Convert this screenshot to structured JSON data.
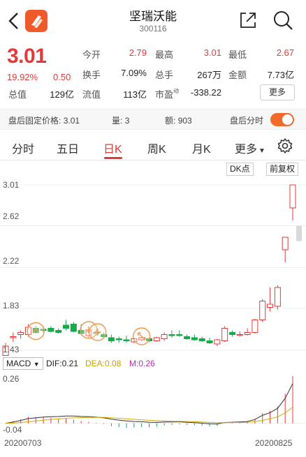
{
  "header": {
    "title": "坚瑞沃能",
    "code": "300116"
  },
  "quote": {
    "price": "3.01",
    "change_pct": "19.92%",
    "change_amt": "0.50",
    "open_label": "今开",
    "open_value": "2.79",
    "high_label": "最高",
    "high_value": "3.01",
    "low_label": "最低",
    "low_value": "2.67",
    "turnover_label": "换手",
    "turnover_value": "7.09%",
    "volume_label": "总手",
    "volume_value": "267万",
    "amount_label": "金额",
    "amount_value": "7.73亿",
    "mktcap_label": "总值",
    "mktcap_value": "129亿",
    "float_label": "流值",
    "float_value": "113亿",
    "pe_label": "市盈",
    "pe_sup": "动",
    "pe_value": "-338.22",
    "more_label": "更多"
  },
  "after_hours": {
    "price_label": "盘后固定价格:",
    "price_value": "3.01",
    "vol_label": "量:",
    "vol_value": "3",
    "amt_label": "额:",
    "amt_value": "903",
    "timeshare_label": "盘后分时",
    "toggle_on": true
  },
  "tabs": [
    {
      "label": "分时"
    },
    {
      "label": "五日"
    },
    {
      "label": "日K",
      "active": true
    },
    {
      "label": "周K"
    },
    {
      "label": "月K"
    },
    {
      "label": "更多"
    }
  ],
  "chart_buttons": {
    "dk_label": "DK点",
    "adjust_label": "前复权"
  },
  "colors": {
    "up": "#e23a3a",
    "down": "#1aa84c",
    "accent": "#f06a2a"
  },
  "chart_data": [
    {
      "type": "candlestick",
      "y_ticks": [
        "3.01",
        "2.62",
        "2.22",
        "1.83",
        "1.43"
      ],
      "ylim": [
        1.43,
        3.01
      ],
      "candles": [
        {
          "o": 1.38,
          "h": 1.5,
          "l": 1.37,
          "c": 1.47
        },
        {
          "o": 1.55,
          "h": 1.6,
          "l": 1.51,
          "c": 1.56
        },
        {
          "o": 1.58,
          "h": 1.62,
          "l": 1.54,
          "c": 1.6
        },
        {
          "o": 1.58,
          "h": 1.68,
          "l": 1.56,
          "c": 1.65
        },
        {
          "o": 1.64,
          "h": 1.66,
          "l": 1.59,
          "c": 1.6
        },
        {
          "o": 1.63,
          "h": 1.66,
          "l": 1.6,
          "c": 1.62
        },
        {
          "o": 1.64,
          "h": 1.66,
          "l": 1.6,
          "c": 1.61
        },
        {
          "o": 1.62,
          "h": 1.64,
          "l": 1.59,
          "c": 1.6
        },
        {
          "o": 1.67,
          "h": 1.72,
          "l": 1.62,
          "c": 1.64
        },
        {
          "o": 1.68,
          "h": 1.7,
          "l": 1.6,
          "c": 1.61
        },
        {
          "o": 1.62,
          "h": 1.68,
          "l": 1.58,
          "c": 1.59
        },
        {
          "o": 1.57,
          "h": 1.62,
          "l": 1.55,
          "c": 1.61
        },
        {
          "o": 1.6,
          "h": 1.63,
          "l": 1.57,
          "c": 1.59
        },
        {
          "o": 1.58,
          "h": 1.6,
          "l": 1.55,
          "c": 1.56
        },
        {
          "o": 1.55,
          "h": 1.58,
          "l": 1.5,
          "c": 1.52
        },
        {
          "o": 1.54,
          "h": 1.56,
          "l": 1.5,
          "c": 1.53
        },
        {
          "o": 1.53,
          "h": 1.57,
          "l": 1.5,
          "c": 1.52
        },
        {
          "o": 1.51,
          "h": 1.55,
          "l": 1.5,
          "c": 1.54
        },
        {
          "o": 1.53,
          "h": 1.56,
          "l": 1.52,
          "c": 1.55
        },
        {
          "o": 1.54,
          "h": 1.55,
          "l": 1.51,
          "c": 1.52
        },
        {
          "o": 1.52,
          "h": 1.56,
          "l": 1.51,
          "c": 1.55
        },
        {
          "o": 1.54,
          "h": 1.6,
          "l": 1.52,
          "c": 1.58
        },
        {
          "o": 1.58,
          "h": 1.62,
          "l": 1.55,
          "c": 1.57
        },
        {
          "o": 1.58,
          "h": 1.62,
          "l": 1.56,
          "c": 1.57
        },
        {
          "o": 1.56,
          "h": 1.58,
          "l": 1.53,
          "c": 1.54
        },
        {
          "o": 1.55,
          "h": 1.58,
          "l": 1.52,
          "c": 1.53
        },
        {
          "o": 1.54,
          "h": 1.56,
          "l": 1.51,
          "c": 1.52
        },
        {
          "o": 1.52,
          "h": 1.55,
          "l": 1.49,
          "c": 1.5
        },
        {
          "o": 1.49,
          "h": 1.54,
          "l": 1.47,
          "c": 1.53
        },
        {
          "o": 1.52,
          "h": 1.66,
          "l": 1.51,
          "c": 1.64
        },
        {
          "o": 1.6,
          "h": 1.62,
          "l": 1.56,
          "c": 1.58
        },
        {
          "o": 1.58,
          "h": 1.61,
          "l": 1.56,
          "c": 1.58
        },
        {
          "o": 1.58,
          "h": 1.64,
          "l": 1.57,
          "c": 1.6
        },
        {
          "o": 1.6,
          "h": 1.73,
          "l": 1.59,
          "c": 1.72
        },
        {
          "o": 1.72,
          "h": 1.92,
          "l": 1.7,
          "c": 1.9
        },
        {
          "o": 1.84,
          "h": 2.03,
          "l": 1.8,
          "c": 1.87
        },
        {
          "o": 1.85,
          "h": 2.05,
          "l": 1.82,
          "c": 2.03
        },
        {
          "o": 2.39,
          "h": 2.43,
          "l": 2.27,
          "c": 2.51
        },
        {
          "o": 2.79,
          "h": 3.01,
          "l": 2.67,
          "c": 3.01
        }
      ],
      "annotations": [
        "up-arrow-badge",
        "fast-forward-badge",
        "fast-forward-badge",
        "expand-badge"
      ]
    },
    {
      "type": "macd",
      "indicator_label": "MACD",
      "dif_label": "DIF:",
      "dif_value": "0.21",
      "dea_label": "DEA:",
      "dea_value": "0.08",
      "m_label": "M:",
      "m_value": "0.26",
      "y_ticks": [
        "0.26",
        "-0.04"
      ],
      "x_ticks": [
        "20200703",
        "20200825"
      ]
    }
  ]
}
